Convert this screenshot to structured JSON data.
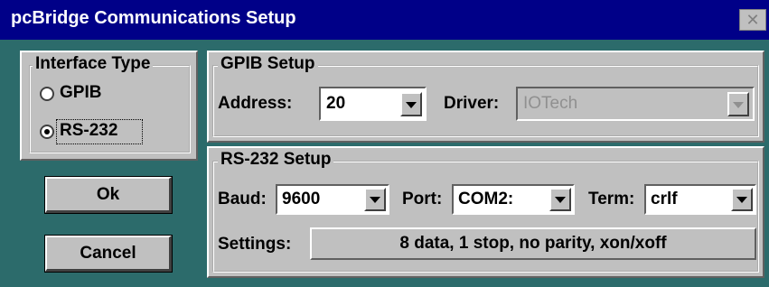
{
  "window": {
    "title": "pcBridge Communications Setup",
    "close_glyph": "✕"
  },
  "interface_type": {
    "legend": "Interface Type",
    "options": [
      {
        "label": "GPIB",
        "selected": false
      },
      {
        "label": "RS-232",
        "selected": true
      }
    ]
  },
  "gpib": {
    "legend": "GPIB Setup",
    "address_label": "Address:",
    "address_value": "20",
    "driver_label": "Driver:",
    "driver_value": "IOTech",
    "driver_enabled": false
  },
  "rs232": {
    "legend": "RS-232 Setup",
    "baud_label": "Baud:",
    "baud_value": "9600",
    "port_label": "Port:",
    "port_value": "COM2:",
    "term_label": "Term:",
    "term_value": "crlf",
    "settings_label": "Settings:",
    "settings_value": "8 data, 1 stop, no parity, xon/xoff"
  },
  "buttons": {
    "ok_label": "Ok",
    "cancel_label": "Cancel"
  },
  "colors": {
    "titlebar": "#000088",
    "face": "#c0c0c0",
    "background": "#2c6b6b"
  },
  "icons": [
    "close-icon",
    "dropdown-arrow-icon",
    "radio-button-icon"
  ]
}
